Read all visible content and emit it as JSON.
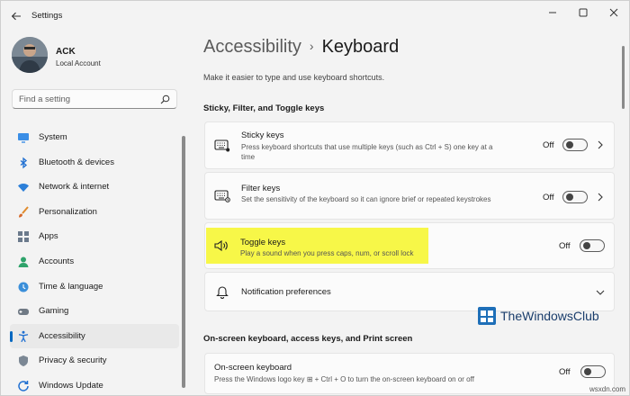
{
  "app": {
    "title": "Settings"
  },
  "user": {
    "name": "ACK",
    "account_type": "Local Account"
  },
  "search": {
    "placeholder": "Find a setting"
  },
  "sidebar": {
    "items": [
      {
        "label": "System",
        "icon": "monitor-icon",
        "active": false
      },
      {
        "label": "Bluetooth & devices",
        "icon": "bluetooth-icon",
        "active": false
      },
      {
        "label": "Network & internet",
        "icon": "wifi-icon",
        "active": false
      },
      {
        "label": "Personalization",
        "icon": "brush-icon",
        "active": false
      },
      {
        "label": "Apps",
        "icon": "apps-icon",
        "active": false
      },
      {
        "label": "Accounts",
        "icon": "person-icon",
        "active": false
      },
      {
        "label": "Time & language",
        "icon": "globe-clock-icon",
        "active": false
      },
      {
        "label": "Gaming",
        "icon": "gamepad-icon",
        "active": false
      },
      {
        "label": "Accessibility",
        "icon": "accessibility-icon",
        "active": true
      },
      {
        "label": "Privacy & security",
        "icon": "shield-icon",
        "active": false
      },
      {
        "label": "Windows Update",
        "icon": "update-icon",
        "active": false
      }
    ]
  },
  "breadcrumb": {
    "parent": "Accessibility",
    "separator": "›",
    "current": "Keyboard"
  },
  "page": {
    "description": "Make it easier to type and use keyboard shortcuts."
  },
  "sections": {
    "sticky": {
      "title": "Sticky, Filter, and Toggle keys",
      "cards": [
        {
          "title": "Sticky keys",
          "description": "Press keyboard shortcuts that use multiple keys (such as Ctrl + S) one key at a time",
          "state": "Off"
        },
        {
          "title": "Filter keys",
          "description": "Set the sensitivity of the keyboard so it can ignore brief or repeated keystrokes",
          "state": "Off"
        },
        {
          "title": "Toggle keys",
          "description": "Play a sound when you press caps, num, or scroll lock",
          "state": "Off"
        },
        {
          "title": "Notification preferences"
        }
      ]
    },
    "onscreen": {
      "title": "On-screen keyboard, access keys, and Print screen",
      "cards": [
        {
          "title": "On-screen keyboard",
          "description": "Press the Windows logo key ⊞ + Ctrl + O to turn the on-screen keyboard on or off",
          "state": "Off"
        }
      ]
    }
  },
  "watermark": {
    "text": "TheWindowsClub",
    "site": "wsxdn.com"
  },
  "colors": {
    "accent": "#0067c0",
    "highlight": "#f7f748",
    "background": "#f3f3f3",
    "card": "#fbfbfb"
  }
}
